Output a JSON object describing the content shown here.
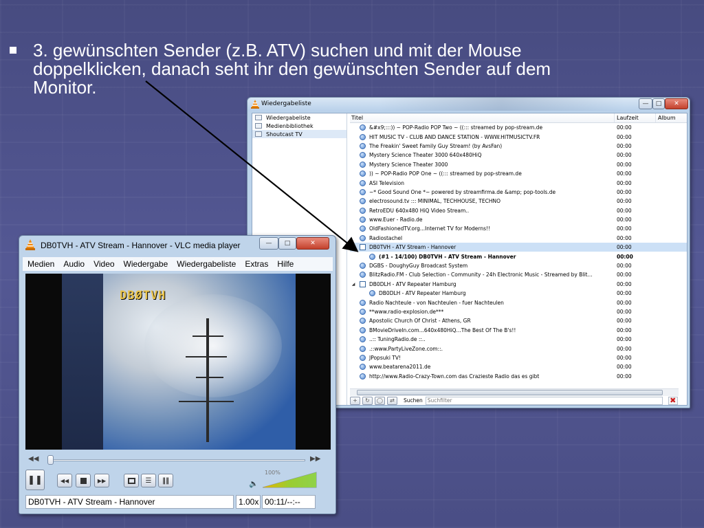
{
  "slide": {
    "bullet_text": "3. gewünschten Sender (z.B. ATV) suchen und mit der Mouse doppelklicken, danach seht ihr den gewünschten Sender auf dem Monitor."
  },
  "playlist_window": {
    "title": "Wiedergabeliste",
    "sidebar": [
      {
        "label": "Wiedergabeliste"
      },
      {
        "label": "Medienbibliothek"
      },
      {
        "label": "Shoutcast TV"
      }
    ],
    "columns": {
      "title": "Titel",
      "duration": "Laufzeit",
      "album": "Album"
    },
    "rows": [
      {
        "title": "&#x9;:::)) ~ POP-Radio POP Two ~ ((::: streamed by pop-stream.de",
        "time": "00:00"
      },
      {
        "title": "HIT MUSIC TV - CLUB AND DANCE STATION - WWW.HITMUSICTV.FR",
        "time": "00:00"
      },
      {
        "title": "The Freakin' Sweet Family Guy Stream! (by AvsFan)",
        "time": "00:00"
      },
      {
        "title": "Mystery Science Theater 3000 640x480HiQ",
        "time": "00:00"
      },
      {
        "title": "Mystery Science Theater 3000",
        "time": "00:00"
      },
      {
        "title": ")) ~ POP-Radio POP One ~ ((::: streamed by pop-stream.de",
        "time": "00:00"
      },
      {
        "title": "ASI Television",
        "time": "00:00"
      },
      {
        "title": "~* Good Sound One *~ powered by streamfirma.de &amp; pop-tools.de",
        "time": "00:00"
      },
      {
        "title": " electrosound.tv ::: MINIMAL, TECHHOUSE, TECHNO",
        "time": "00:00"
      },
      {
        "title": "RetroEDU 640x480 HiQ Video Stream..",
        "time": "00:00"
      },
      {
        "title": "www.Euer - Radio.de",
        "time": "00:00"
      },
      {
        "title": "OldFashionedTV.org...Internet TV for Moderns!!",
        "time": "00:00"
      },
      {
        "title": "Radiostachel",
        "time": "00:00"
      },
      {
        "title": "DB0TVH - ATV Stream - Hannover",
        "time": "00:00"
      },
      {
        "title": "(#1 - 14/100) DB0TVH - ATV Stream - Hannover",
        "time": "00:00"
      },
      {
        "title": "DGBS - DoughyGuy Broadcast System",
        "time": "00:00"
      },
      {
        "title": "BlitzRadio.FM  - Club Selection - Community - 24h Electronic Music - Streamed by Blit...",
        "time": "00:00"
      },
      {
        "title": "DB0DLH - ATV Repeater Hamburg",
        "time": "00:00"
      },
      {
        "title": "DB0DLH - ATV Repeater Hamburg",
        "time": "00:00"
      },
      {
        "title": "Radio Nachteule - von Nachteulen - fuer Nachteulen",
        "time": "00:00"
      },
      {
        "title": "**www.radio-explosion.de***",
        "time": "00:00"
      },
      {
        "title": "Apostolic Church Of Christ - Athens, GR",
        "time": "00:00"
      },
      {
        "title": "BMovieDriveIn.com...640x480HiQ...The Best Of The B's!!",
        "time": "00:00"
      },
      {
        "title": " ..:: TuningRadio.de ::..",
        "time": "00:00"
      },
      {
        "title": ".::www.PartyLiveZone.com::.",
        "time": "00:00"
      },
      {
        "title": "JPopsuki TV!",
        "time": "00:00"
      },
      {
        "title": "www.beatarena2011.de",
        "time": "00:00"
      },
      {
        "title": "http://www.Radio-Crazy-Town.com das Crazieste Radio das es gibt",
        "time": "00:00"
      }
    ],
    "search_label": "Suchen",
    "search_placeholder": "Suchfilter"
  },
  "vlc_window": {
    "title": "DB0TVH - ATV Stream - Hannover - VLC media player",
    "menu": [
      "Medien",
      "Audio",
      "Video",
      "Wiedergabe",
      "Wiedergabeliste",
      "Extras",
      "Hilfe"
    ],
    "osd_text": "DBØTVH",
    "volume_label": "100%",
    "volume_level": 1.0,
    "status_title": "DB0TVH - ATV Stream - Hannover",
    "speed": "1.00x",
    "time": "00:11/--:--"
  },
  "colors": {
    "background": "#4b4f86",
    "selection": "#cce0f6",
    "close_button": "#c3412c"
  }
}
